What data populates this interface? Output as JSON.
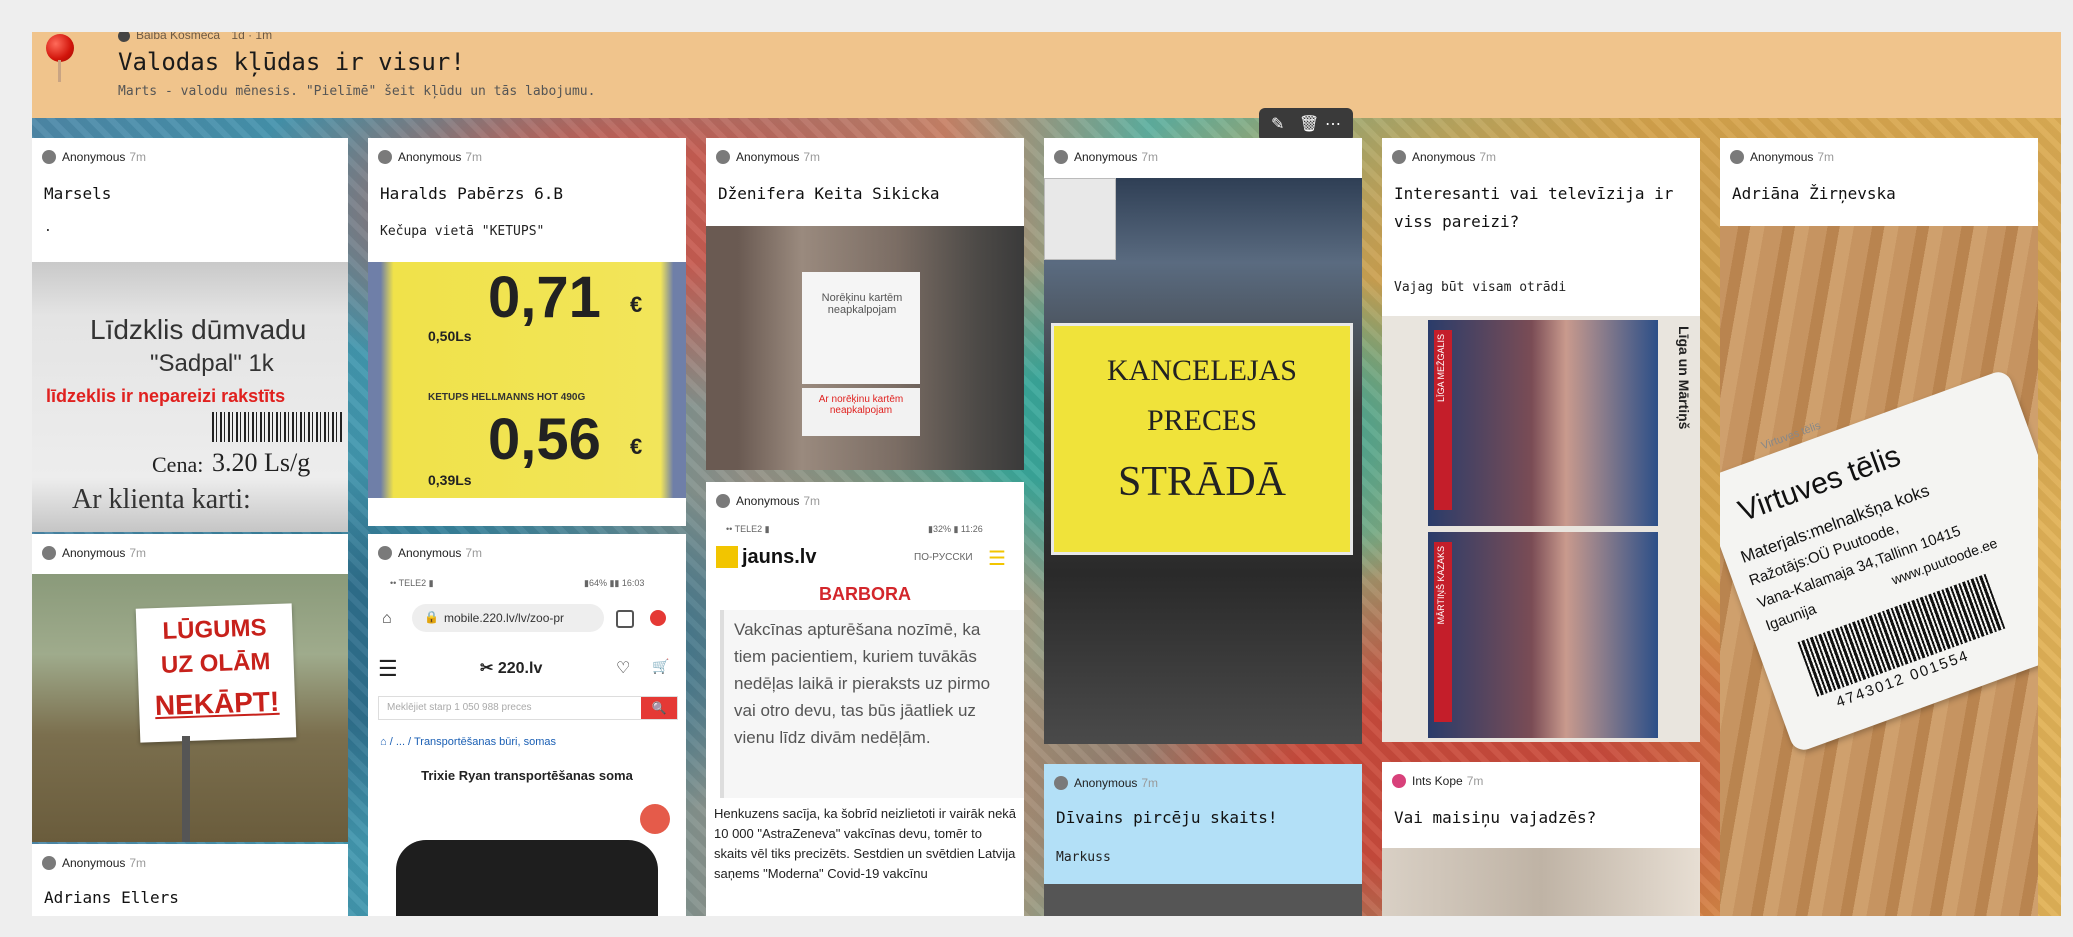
{
  "header": {
    "author": "Baiba Kosmeca",
    "time": "1d · 1m",
    "title": "Valodas kļūdas ir visur!",
    "subtitle": "Marts - valodu mēnesis. \"Pielīmē\" šeit kļūdu un tās labojumu."
  },
  "toolbar": {
    "edit_icon": "pencil-icon",
    "delete_icon": "trash-icon",
    "more_icon": "more-dots-icon"
  },
  "posts": {
    "marsels": {
      "author": "Anonymous",
      "time": "7m",
      "title": "Marsels",
      "body": ".",
      "photo": {
        "line1": "Līdzklis dūmvadu",
        "line2": "\"Sadpal\" 1k",
        "correction": "līdzeklis ir nepareizi rakstīts",
        "price_label": "Cena:",
        "price": "3.20 Ls/g",
        "footer": "Ar klienta karti:"
      }
    },
    "lugums": {
      "author": "Anonymous",
      "time": "7m",
      "photo": {
        "line1": "LŪGUMS",
        "line2": "UZ OLĀM",
        "line3": "NEKĀPT!"
      }
    },
    "adrians": {
      "author": "Anonymous",
      "time": "7m",
      "title": "Adrians Ellers"
    },
    "haralds": {
      "author": "Anonymous",
      "time": "7m",
      "title": "Haralds Pabērzs 6.B",
      "body": "Kečupa vietā \"KETUPS\"",
      "photo": {
        "price1": "0,71",
        "cur1": "€",
        "weight1": "0,50Ls",
        "product": "KETUPS HELLMANNS HOT 490G",
        "price2": "0,56",
        "cur2": "€",
        "weight2": "0,39Ls"
      }
    },
    "screenshot220": {
      "author": "Anonymous",
      "time": "7m",
      "photo": {
        "status_left": "•• TELE2 ▮",
        "status_right": "▮64% ▮▮ 16:03",
        "url": "mobile.220.lv/lv/zoo-pr",
        "logo": "220.lv",
        "search_placeholder": "Meklējiet starp 1 050 988 preces",
        "breadcrumb": "/ ... / Transportēšanas būri, somas",
        "product": "Trixie Ryan transportēšanas soma"
      }
    },
    "dzenifera": {
      "author": "Anonymous",
      "time": "7m",
      "title": "Dženifera Keita Sikicka",
      "photo": {
        "sign_wrong": "Norēķinu kartēm neapkalpojam",
        "sign_right": "Ar norēķinu kartēm neapkalpojam"
      }
    },
    "jauns": {
      "author": "Anonymous",
      "time": "7m",
      "photo": {
        "status_left": "•• TELE2 ▮",
        "status_right": "▮32% ▮ 11:26",
        "logo": "jauns.lv",
        "lang": "ПО-РУССКИ",
        "ad": "BARBORA",
        "quote": "Vakcīnas apturēšana nozīmē, ka tiem pacientiem, kuriem tuvākās nedēļas laikā ir pieraksts uz pirmo vai otro devu, tas būs jāatliek uz vienu līdz divām nedēļām.",
        "article": "Henkuzens sacīja, ka šobrīd neizlietoti ir vairāk nekā 10 000 \"AstraZeneva\" vakcīnas devu, tomēr to skaits vēl tiks precizēts. Sestdien un svētdien Latvija saņems \"Moderna\" Covid-19 vakcīnu"
      }
    },
    "kancelejas": {
      "author": "Anonymous",
      "time": "7m",
      "photo": {
        "line1": "KANCELEJAS",
        "line2": "PRECES",
        "line3": "STRĀDĀ"
      }
    },
    "divains": {
      "author": "Anonymous",
      "time": "7m",
      "title": "Dīvains pircēju skaits!",
      "body": "Markuss"
    },
    "televizija": {
      "author": "Anonymous",
      "time": "7m",
      "title": "Interesanti vai televīzija ir viss pareizi?",
      "body": "Vajag būt visam otrādi",
      "photo": {
        "tag1": "LĪGA MEŽGALIS",
        "tag2": "MĀRTIŅŠ KAZAKS",
        "side": "Līga un Mārtiņš"
      }
    },
    "maisini": {
      "author": "Ints Kope",
      "time": "7m",
      "title": "Vai maisiņu vajadzēs?"
    },
    "adriana": {
      "author": "Anonymous",
      "time": "7m",
      "title": "Adriāna Žirņevska",
      "photo": {
        "small": "Virtuves tēlis",
        "big": "Virtuves tēlis",
        "l1": "Materjals:melnalkšņa koks",
        "l2": "Ražotājs:OÜ Puutoode,",
        "l3": "Vana-Kalamaja 34,Tallinn 10415",
        "l4": "Igaunija",
        "l5": "www.puutoode.ee",
        "barcode": "4743012 001554"
      }
    }
  },
  "colors": {
    "header": "#f0c48c",
    "blue_card": "#b3e0f7",
    "pin": "#d1140a"
  }
}
